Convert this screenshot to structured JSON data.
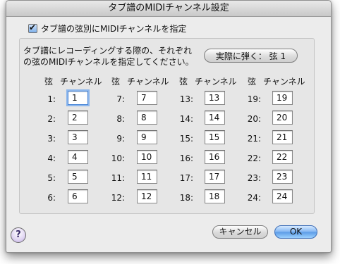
{
  "window": {
    "title": "タブ譜のMIDIチャンネル設定"
  },
  "main_checkbox": {
    "label": "タブ譜の弦別にMIDIチャンネルを指定",
    "checked": true
  },
  "description": "タブ譜にレコーディングする際の、それぞれの弦のMIDIチャンネルを指定してください。",
  "play_button": {
    "label": "実際に弾く： 弦 1"
  },
  "column_header": {
    "string": "弦",
    "channel": "チャンネル"
  },
  "strings": [
    {
      "label": "1:",
      "value": "1"
    },
    {
      "label": "2:",
      "value": "2"
    },
    {
      "label": "3:",
      "value": "3"
    },
    {
      "label": "4:",
      "value": "4"
    },
    {
      "label": "5:",
      "value": "5"
    },
    {
      "label": "6:",
      "value": "6"
    },
    {
      "label": "7:",
      "value": "7"
    },
    {
      "label": "8:",
      "value": "8"
    },
    {
      "label": "9:",
      "value": "9"
    },
    {
      "label": "10:",
      "value": "10"
    },
    {
      "label": "11:",
      "value": "11"
    },
    {
      "label": "12:",
      "value": "12"
    },
    {
      "label": "13:",
      "value": "13"
    },
    {
      "label": "14:",
      "value": "14"
    },
    {
      "label": "15:",
      "value": "15"
    },
    {
      "label": "16:",
      "value": "16"
    },
    {
      "label": "17:",
      "value": "17"
    },
    {
      "label": "18:",
      "value": "18"
    },
    {
      "label": "19:",
      "value": "19"
    },
    {
      "label": "20:",
      "value": "20"
    },
    {
      "label": "21:",
      "value": "21"
    },
    {
      "label": "22:",
      "value": "22"
    },
    {
      "label": "23:",
      "value": "23"
    },
    {
      "label": "24:",
      "value": "24"
    }
  ],
  "help_button": {
    "label": "?"
  },
  "buttons": {
    "cancel": "キャンセル",
    "ok": "OK"
  },
  "colors": {
    "ok_accent": "#5b9be6",
    "help_accent": "#b8a5dc",
    "focus_ring": "#8cb6ec"
  }
}
